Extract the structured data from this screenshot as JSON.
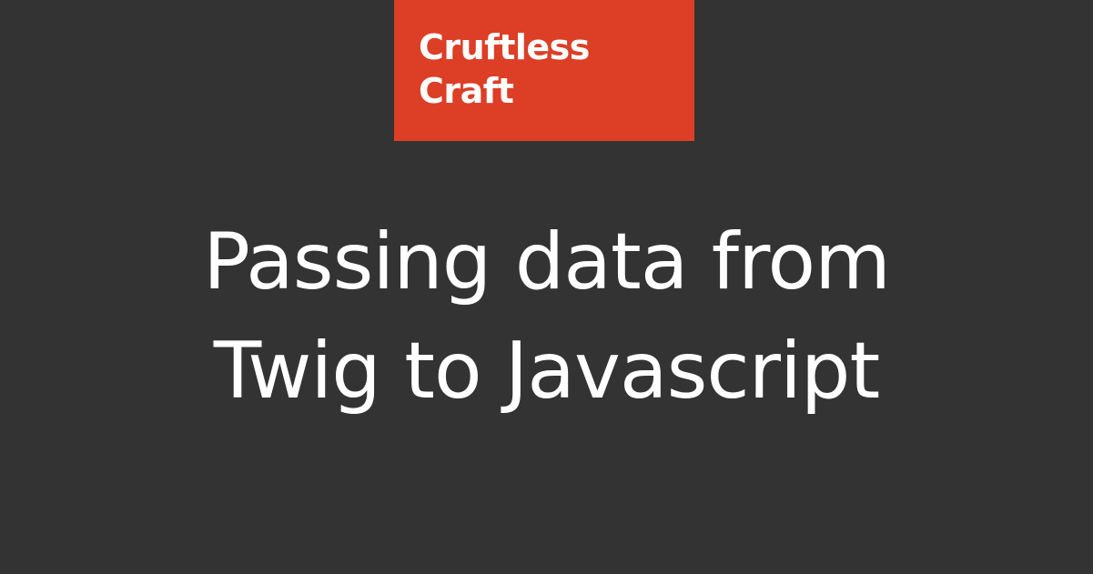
{
  "colors": {
    "background": "#333333",
    "brand": "#dc3e26",
    "text": "#ffffff"
  },
  "logo": {
    "line1": "Cruftless",
    "line2": "Craft"
  },
  "headline": {
    "line1": "Passing data from",
    "line2": "Twig to Javascript"
  }
}
